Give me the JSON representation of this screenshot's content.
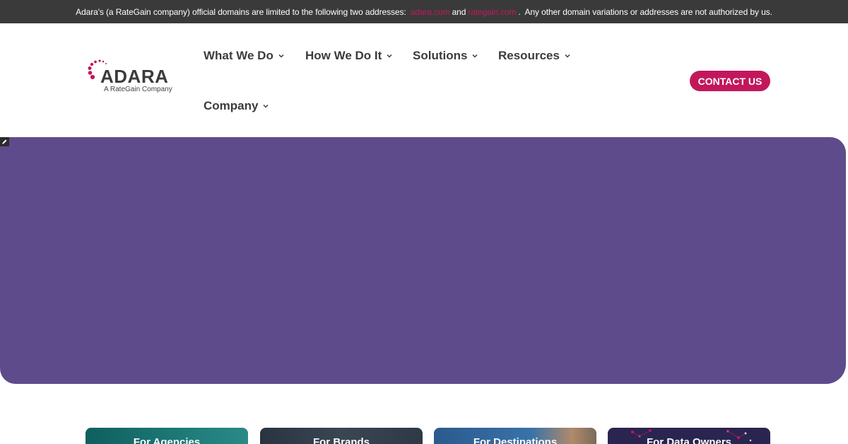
{
  "notice": {
    "prefix": "Adara's (a RateGain company) official domains are limited to the following two addresses: ",
    "domain_1": "adara.com",
    "joiner": "and",
    "domain_2": "rategain.com",
    "suffix": ".  Any other domain variations or addresses are not authorized by us."
  },
  "logo": {
    "wordmark": "ADARA",
    "tagline": "A RateGain Company"
  },
  "nav": {
    "items": [
      {
        "label": "What We Do"
      },
      {
        "label": "How We Do It"
      },
      {
        "label": "Solutions"
      },
      {
        "label": "Resources"
      },
      {
        "label": "Company"
      }
    ]
  },
  "contact_label": "CONTACT US",
  "cards": [
    {
      "label": "For Agencies"
    },
    {
      "label": "For Brands"
    },
    {
      "label": "For Destinations"
    },
    {
      "label": "For Data Owners"
    }
  ],
  "colors": {
    "brand_pink": "#c2185b",
    "hero_purple": "#5e4b8b",
    "topbar_bg": "#3a3a3a",
    "nav_text": "#3c3c3c"
  },
  "icons": {
    "nav_dropdown": "chevron-down-icon",
    "edit": "edit-pencil-icon"
  }
}
